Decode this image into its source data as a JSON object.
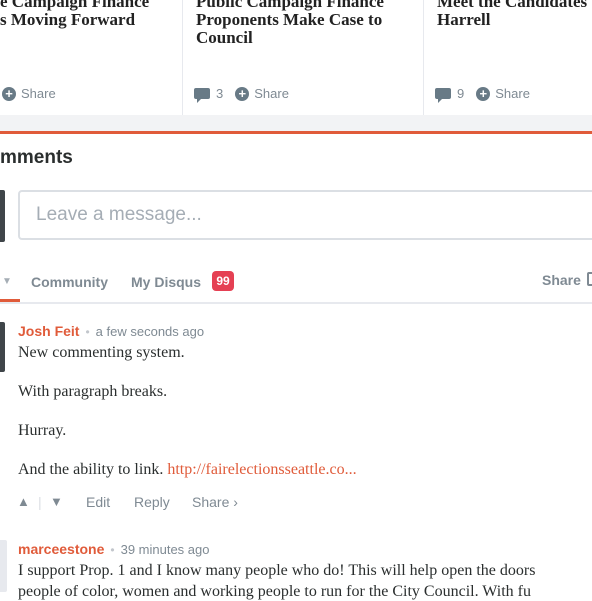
{
  "articles": [
    {
      "title_line1": "e Campaign Finance",
      "title_line2": "s Moving Forward",
      "title_line3": "",
      "comment_count": "",
      "share_label": "Share"
    },
    {
      "title_line1": "Public Campaign Finance",
      "title_line2": "Proponents Make Case to",
      "title_line3": "Council",
      "comment_count": "3",
      "share_label": "Share"
    },
    {
      "title_line1": "Meet the Candidates",
      "title_line2": "Harrell",
      "title_line3": "",
      "comment_count": "9",
      "share_label": "Share"
    }
  ],
  "comments_heading": "mments",
  "message_input": {
    "placeholder": "Leave a message...",
    "value": ""
  },
  "tabs": {
    "community": "Community",
    "my_disqus": "My Disqus",
    "badge": "99",
    "share": "Share"
  },
  "comments": [
    {
      "author": "Josh Feit",
      "time": "a few seconds ago",
      "paragraphs": [
        "New commenting system.",
        "With paragraph breaks.",
        "Hurray."
      ],
      "link_prefix": "And the ability to link. ",
      "link_text": "http://fairelectionsseattle.co...",
      "actions": {
        "edit": "Edit",
        "reply": "Reply",
        "share": "Share ›"
      }
    },
    {
      "author": "marceestone",
      "time": "39 minutes ago",
      "line1": "I support Prop. 1 and I know many people who do! This will help open the doors",
      "line2": "people of color, women and working people to run for the City Council. With fu"
    }
  ],
  "colors": {
    "accent": "#e05b3a",
    "badge": "#e54053",
    "muted": "#7f8a93"
  }
}
